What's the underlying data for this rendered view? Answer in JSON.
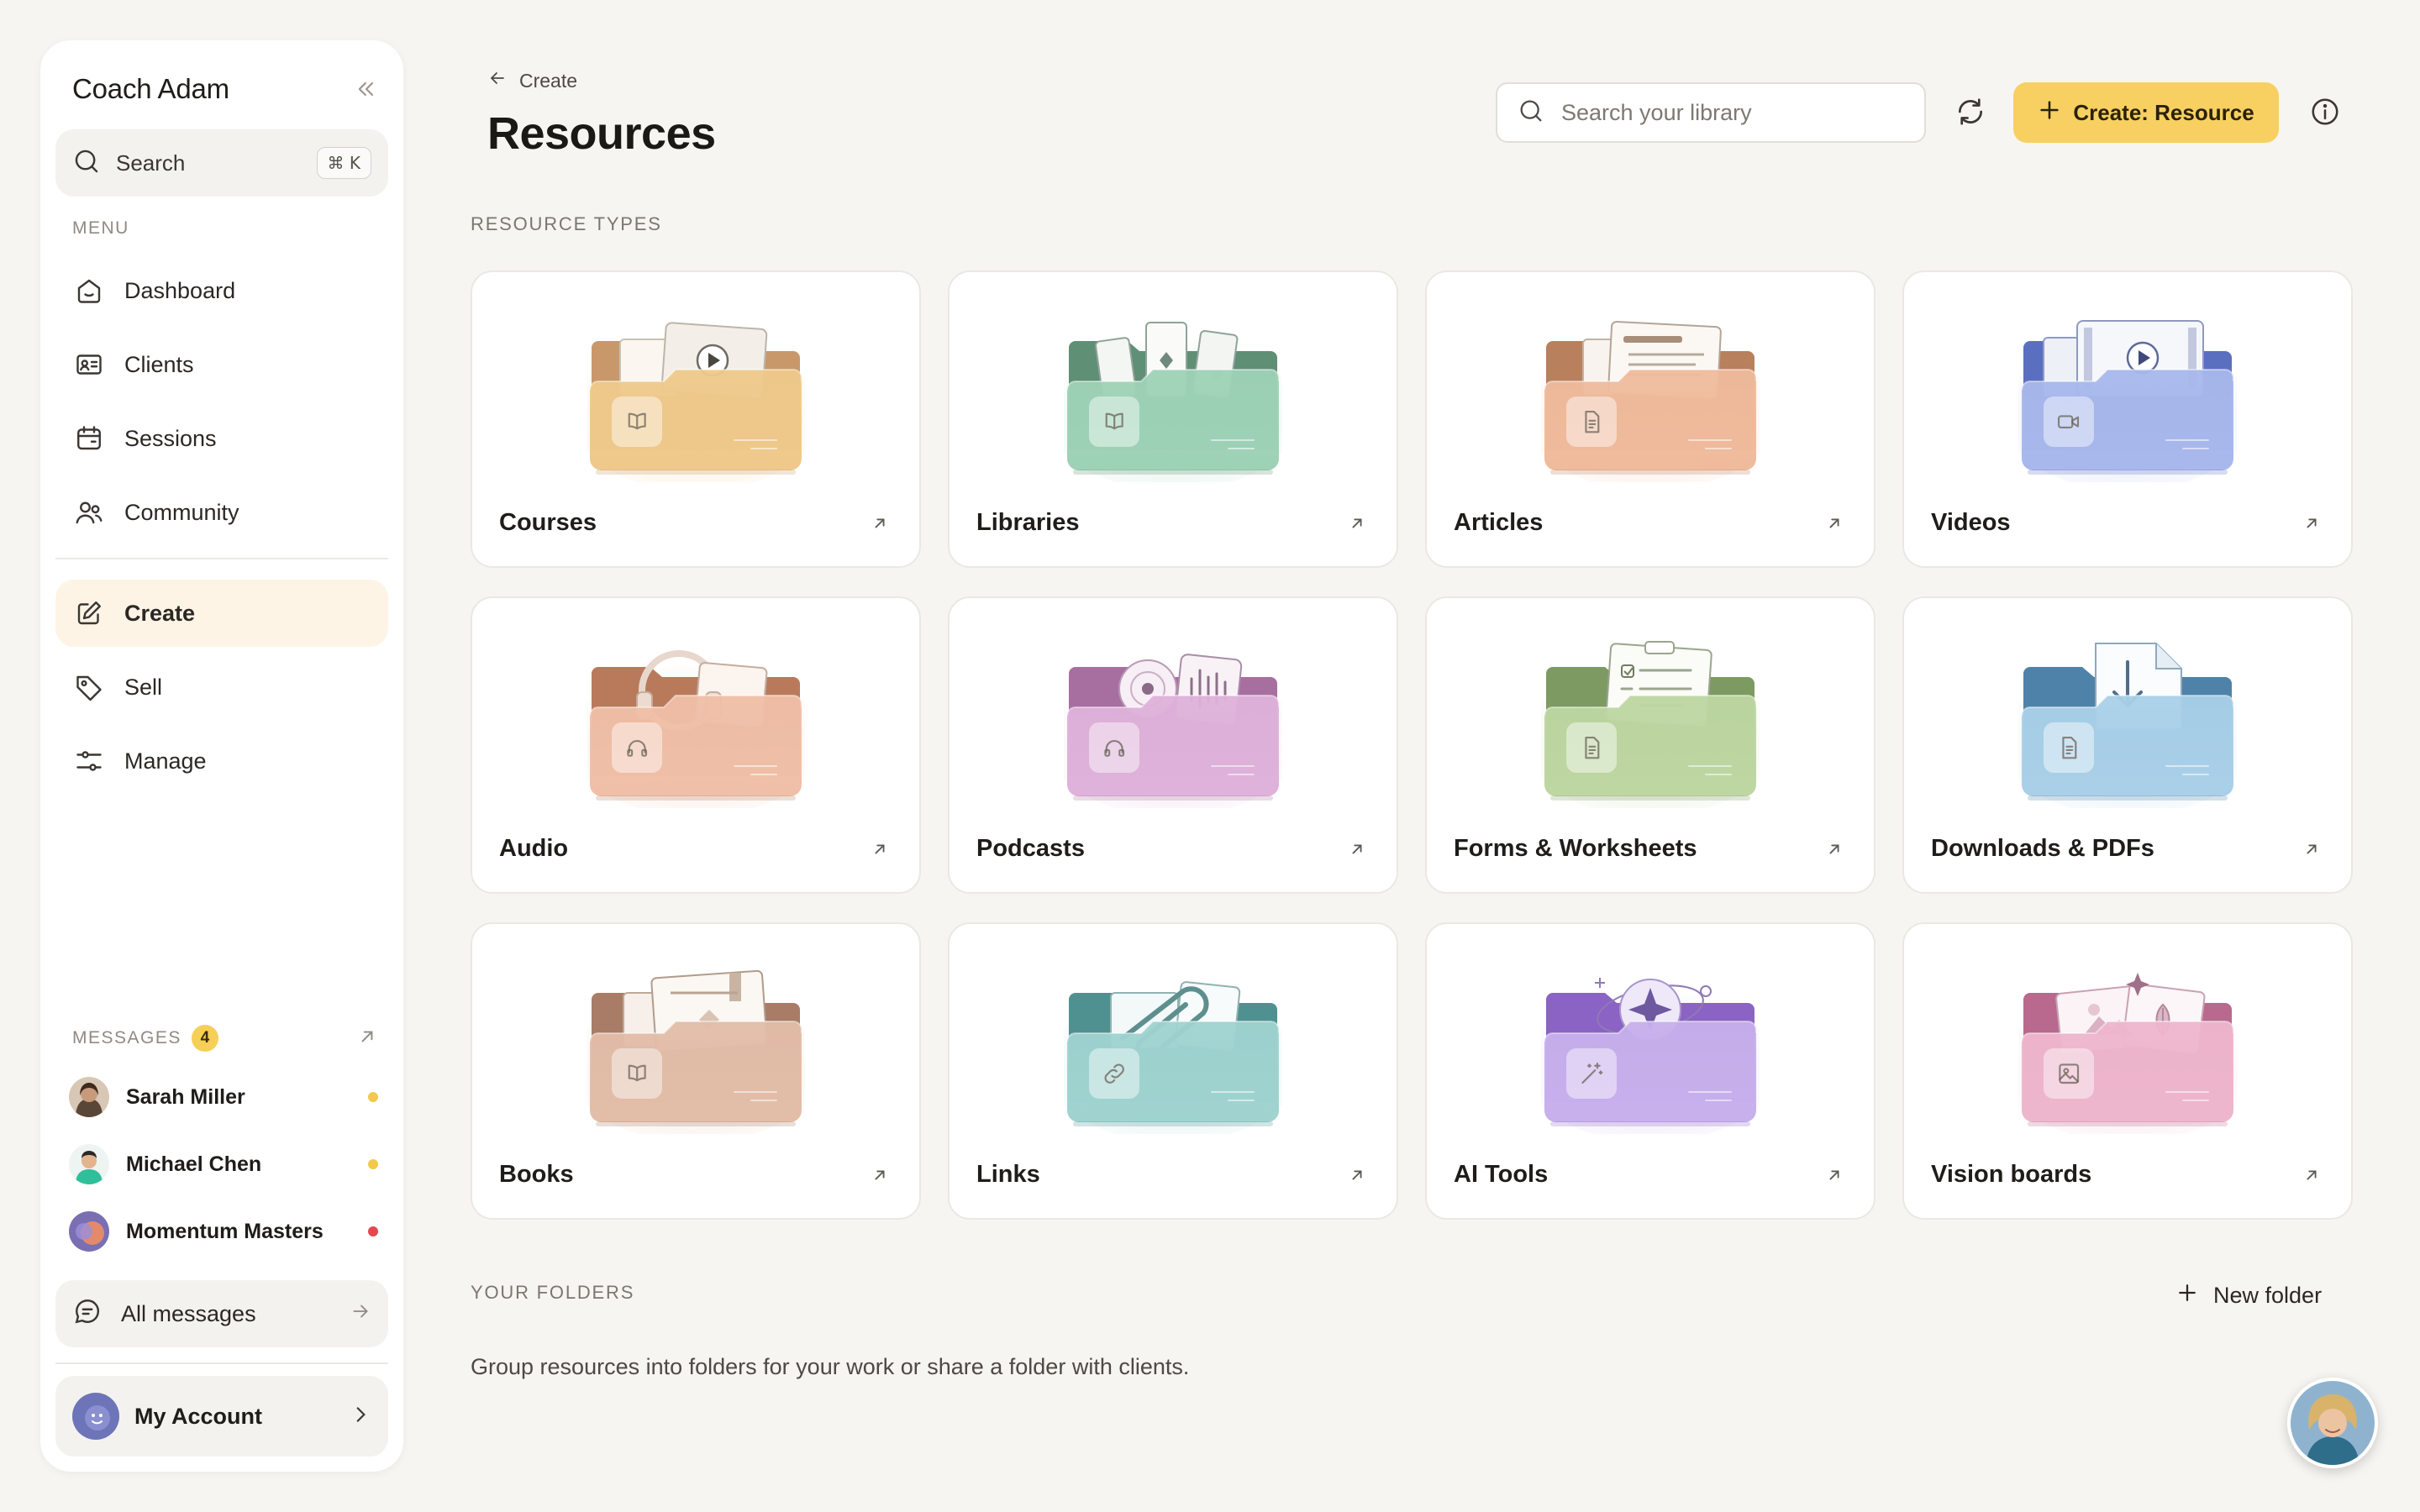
{
  "sidebar": {
    "title": "Coach Adam",
    "search": {
      "label": "Search",
      "shortcut": "⌘ K"
    },
    "menu_label": "MENU",
    "items": [
      {
        "label": "Dashboard",
        "icon": "home-icon"
      },
      {
        "label": "Clients",
        "icon": "id-card-icon"
      },
      {
        "label": "Sessions",
        "icon": "calendar-icon"
      },
      {
        "label": "Community",
        "icon": "users-icon"
      },
      {
        "label": "Create",
        "icon": "edit-icon",
        "active": true
      },
      {
        "label": "Sell",
        "icon": "tag-icon"
      },
      {
        "label": "Manage",
        "icon": "sliders-icon"
      }
    ],
    "messages": {
      "label": "MESSAGES",
      "count": "4",
      "contacts": [
        {
          "name": "Sarah Miller",
          "status_color": "#f2c94c"
        },
        {
          "name": "Michael Chen",
          "status_color": "#f2c94c"
        },
        {
          "name": "Momentum Masters",
          "status_color": "#e5484d"
        }
      ],
      "all_label": "All messages"
    },
    "account_label": "My Account"
  },
  "header": {
    "breadcrumb": "Create",
    "title": "Resources",
    "search_placeholder": "Search your library",
    "create_label": "Create: Resource"
  },
  "resource_types_label": "RESOURCE TYPES",
  "resource_types": [
    {
      "label": "Courses",
      "back": "#c9986a",
      "front": "#efc98b",
      "badge": "book-icon"
    },
    {
      "label": "Libraries",
      "back": "#5f8f74",
      "front": "#9ed2b6",
      "badge": "book-icon"
    },
    {
      "label": "Articles",
      "back": "#b8805d",
      "front": "#efbb9c",
      "badge": "document-icon"
    },
    {
      "label": "Videos",
      "back": "#5b6fc0",
      "front": "#a8b8ec",
      "badge": "video-icon"
    },
    {
      "label": "Audio",
      "back": "#b97a5c",
      "front": "#f0bfa7",
      "badge": "headphones-icon"
    },
    {
      "label": "Podcasts",
      "back": "#a76fa0",
      "front": "#deb2da",
      "badge": "headphones-icon"
    },
    {
      "label": "Forms & Worksheets",
      "back": "#7d9a62",
      "front": "#bdd6a2",
      "badge": "document-icon"
    },
    {
      "label": "Downloads & PDFs",
      "back": "#4f82a8",
      "front": "#a9d0e8",
      "badge": "document-icon"
    },
    {
      "label": "Books",
      "back": "#a87c66",
      "front": "#e2bda8",
      "badge": "book-icon"
    },
    {
      "label": "Links",
      "back": "#4f9191",
      "front": "#9fd3d0",
      "badge": "link-icon"
    },
    {
      "label": "AI Tools",
      "back": "#8a63c4",
      "front": "#c7b0ec",
      "badge": "magic-wand-icon"
    },
    {
      "label": "Vision boards",
      "back": "#b8698d",
      "front": "#eeb6cd",
      "badge": "image-icon"
    }
  ],
  "folders": {
    "label": "YOUR FOLDERS",
    "new_label": "New folder",
    "help_text": "Group resources into folders for your work or share a folder with clients."
  }
}
